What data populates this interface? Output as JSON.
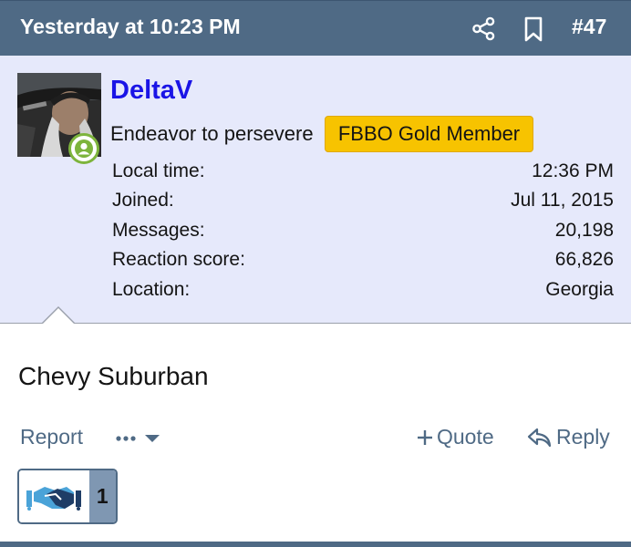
{
  "header": {
    "date": "Yesterday at 10:23 PM",
    "post_number": "#47",
    "icons": {
      "share": "share-icon",
      "bookmark": "bookmark-icon"
    }
  },
  "user": {
    "name": "DeltaV",
    "title": "Endeavor to persevere",
    "banner": "FBBO Gold Member",
    "online_status_icon": "user-online-icon",
    "stats": [
      {
        "label": "Local time:",
        "value": "12:36 PM"
      },
      {
        "label": "Joined:",
        "value": "Jul 11, 2015"
      },
      {
        "label": "Messages:",
        "value": "20,198"
      },
      {
        "label": "Reaction score:",
        "value": "66,826"
      },
      {
        "label": "Location:",
        "value": "Georgia"
      }
    ]
  },
  "message": {
    "text": "Chevy Suburban"
  },
  "actions": {
    "report": "Report",
    "quote": "Quote",
    "reply": "Reply",
    "icons": {
      "more": "more-options-icon",
      "quote": "plus-icon",
      "reply": "reply-arrow-icon"
    }
  },
  "reaction": {
    "count": "1",
    "icon": "handshake-icon"
  },
  "colors": {
    "header_bg": "#4f6a85",
    "userblock_bg": "#e6e9fb",
    "username": "#1a14e6",
    "banner_bg": "#f7c300",
    "link": "#4f6a85",
    "online": "#7db43c",
    "reaction_count_bg": "#7f97b2"
  }
}
